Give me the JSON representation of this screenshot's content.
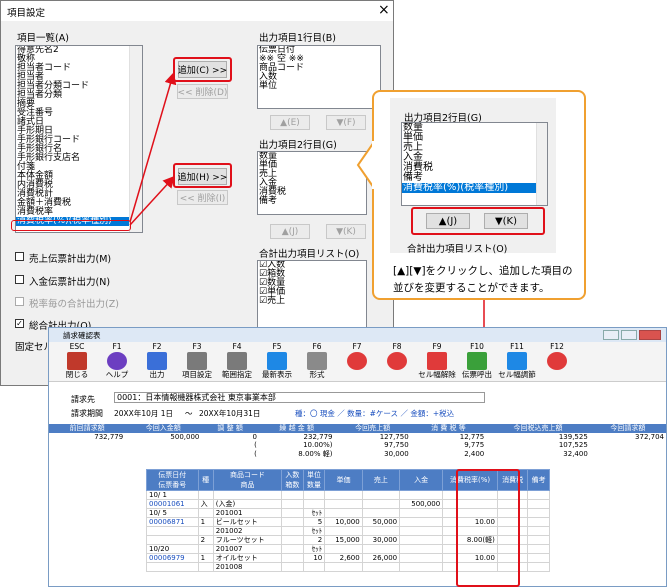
{
  "dialog": {
    "title": "項目設定",
    "close_glyph": "×",
    "list_all_label": "項目一覧(A)",
    "list_all_items": [
      "得意先名2",
      "敬称",
      "担当者コード",
      "担当者",
      "担当者分類コード",
      "担当者分類",
      "摘要",
      "受注番号",
      "諸式日",
      "手形期日",
      "手形銀行コード",
      "手形銀行名",
      "手形銀行支店名",
      "付箋",
      "本体金額",
      "内消費税",
      "消費税計",
      "金額＋消費税",
      "消費税率",
      "消費税率(%)(税率種別)"
    ],
    "row1_label": "出力項目1行目(B)",
    "row1_items": [
      "伝票日付",
      "※※ 空 ※※",
      "商品コード",
      "入数",
      "単位"
    ],
    "add_c": "追加(C) >>",
    "del_d": "<< 削除(D)",
    "up_e": "▲(E)",
    "down_f": "▼(F)",
    "row2_label": "出力項目2行目(G)",
    "row2_items": [
      "数量",
      "単価",
      "売上",
      "入金",
      "消費税",
      "備考"
    ],
    "add_h": "追加(H) >>",
    "del_i": "<< 削除(I)",
    "up_j": "▲(J)",
    "down_k": "▼(K)",
    "total_label": "合計出力項目リスト(O)",
    "total_items": [
      "入数",
      "箱数",
      "数量",
      "単価",
      "売上"
    ],
    "check_sales": "売上伝票計出力(M)",
    "check_payment": "入金伝票計出力(N)",
    "check_tax": "税率毎の合計出力(Z)",
    "check_total": "総合計出力(O)",
    "fixed_label": "固定セル"
  },
  "callout": {
    "title": "出力項目2行目(G)",
    "items": [
      "数量",
      "単価",
      "売上",
      "入金",
      "消費税",
      "備考",
      "消費税率(%)(税率種別)"
    ],
    "up": "▲(J)",
    "down": "▼(K)",
    "total_label": "合計出力項目リスト(O)",
    "description": "[▲][▼]をクリックし、追加した項目の並びを変更することができます。"
  },
  "app": {
    "title": "請求確認表",
    "toolbar": [
      {
        "key": "ESC",
        "label": "閉じる",
        "icon": "close-icon",
        "color": "#c0392b"
      },
      {
        "key": "F1",
        "label": "ヘルプ",
        "icon": "help-icon",
        "color": "#6c3ec1"
      },
      {
        "key": "F2",
        "label": "出力",
        "icon": "printer-icon",
        "color": "#3a6fd8"
      },
      {
        "key": "F3",
        "label": "項目設定",
        "icon": "grid-icon",
        "color": "#7a7a7a"
      },
      {
        "key": "F4",
        "label": "範囲指定",
        "icon": "range-icon",
        "color": "#7a7a7a"
      },
      {
        "key": "F5",
        "label": "最新表示",
        "icon": "refresh-icon",
        "color": "#1e88e5"
      },
      {
        "key": "F6",
        "label": "形式",
        "icon": "gear-icon",
        "color": "#8a8a8a"
      },
      {
        "key": "F7",
        "label": "",
        "icon": "prohibit-icon",
        "color": "#e03a3a"
      },
      {
        "key": "F8",
        "label": "",
        "icon": "prohibit-icon",
        "color": "#e03a3a"
      },
      {
        "key": "F9",
        "label": "セル幅解除",
        "icon": "play-icon",
        "color": "#e03a3a"
      },
      {
        "key": "F10",
        "label": "伝票呼出",
        "icon": "pencil-icon",
        "color": "#3aa03a"
      },
      {
        "key": "F11",
        "label": "セル幅調節",
        "icon": "play-icon",
        "color": "#1e88e5"
      },
      {
        "key": "F12",
        "label": "",
        "icon": "prohibit-icon",
        "color": "#e03a3a"
      }
    ],
    "customer_label": "請求先",
    "customer_value": "0001：日本情報機器株式会社 東京事業本部",
    "period_label": "請求期間",
    "period_from": "20XX年10月 1日",
    "period_sep": "～",
    "period_to": "20XX年10月31日",
    "filter": "種：〇 現金 ／ 数量：#ケース ／ 金額：+税込",
    "summary_headers": [
      "前回請求額",
      "今回入金額",
      "調 整 額",
      "繰 越 金 額",
      "今回売上額",
      "消 費 税 等",
      "今回税込売上額",
      "今回請求額"
    ],
    "summary_rows": [
      [
        "732,779",
        "500,000",
        "0",
        "232,779",
        "127,750",
        "12,775",
        "139,525",
        "372,704"
      ],
      [
        "",
        "",
        "(",
        "10.00%)",
        "97,750",
        "9,775",
        "107,525",
        ""
      ],
      [
        "",
        "",
        "(",
        "8.00% 軽)",
        "30,000",
        "2,400",
        "32,400",
        ""
      ]
    ],
    "table_headers": [
      "伝票日付\n伝票番号",
      "種",
      "商品コード\n商品",
      "入数\n箱数",
      "単位\n数量",
      "単価",
      "売上",
      "入金",
      "消費税率(%)",
      "消費税",
      "備考"
    ],
    "rows": [
      [
        "10/ 1",
        "",
        "",
        "",
        "",
        "",
        "",
        "",
        "",
        "",
        ""
      ],
      [
        "00001061",
        "入",
        "(入金)",
        "",
        "",
        "",
        "",
        "500,000",
        "",
        "",
        ""
      ],
      [
        "10/ 5",
        "",
        "201001",
        "",
        "ｾｯﾄ",
        "",
        "",
        "",
        "",
        "",
        ""
      ],
      [
        "00006871",
        "1",
        "ビールセット",
        "",
        "5",
        "10,000",
        "50,000",
        "",
        "10.00",
        "",
        ""
      ],
      [
        "",
        "",
        "201002",
        "",
        "ｾｯﾄ",
        "",
        "",
        "",
        "",
        "",
        ""
      ],
      [
        "",
        "2",
        "フルーツセット",
        "",
        "2",
        "15,000",
        "30,000",
        "",
        "8.00(軽)",
        "",
        ""
      ],
      [
        "10/20",
        "",
        "201007",
        "",
        "ｾｯﾄ",
        "",
        "",
        "",
        "",
        "",
        ""
      ],
      [
        "00006979",
        "1",
        "オイルセット",
        "",
        "10",
        "2,600",
        "26,000",
        "",
        "10.00",
        "",
        ""
      ],
      [
        "",
        "",
        "201008",
        "",
        "",
        "",
        "",
        "",
        "",
        "",
        ""
      ]
    ]
  },
  "colors": {
    "accent": "#e0101a",
    "callout_border": "#f0a030",
    "header_blue": "#4d7dc4"
  }
}
